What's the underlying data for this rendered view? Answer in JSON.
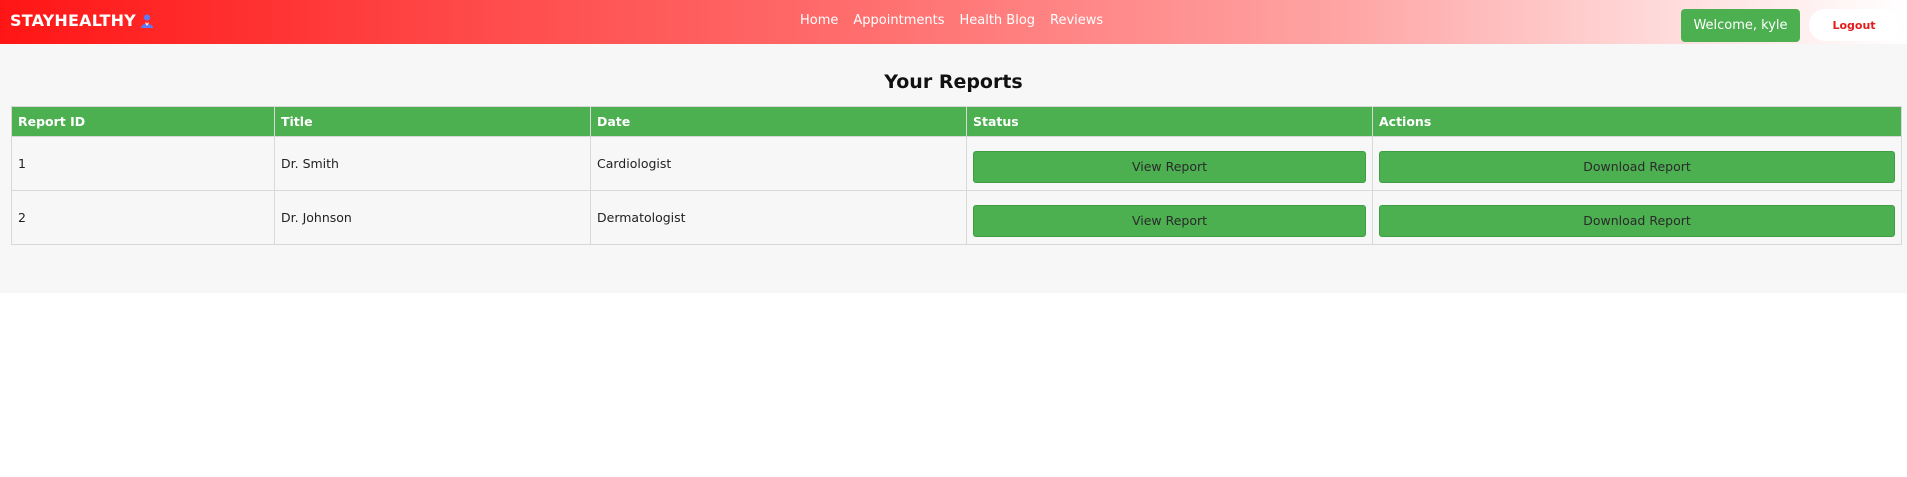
{
  "brand": {
    "name": "STAYHEALTHY",
    "icon": "doctor-icon"
  },
  "nav": {
    "links": [
      "Home",
      "Appointments",
      "Health Blog",
      "Reviews"
    ]
  },
  "user": {
    "welcome_label": "Welcome, kyle",
    "logout_label": "Logout"
  },
  "page": {
    "title": "Your Reports"
  },
  "table": {
    "headers": [
      "Report ID",
      "Title",
      "Date",
      "Status",
      "Actions"
    ],
    "rows": [
      {
        "id": "1",
        "title": "Dr. Smith",
        "date": "Cardiologist",
        "status_btn": "View Report",
        "action_btn": "Download Report"
      },
      {
        "id": "2",
        "title": "Dr. Johnson",
        "date": "Dermatologist",
        "status_btn": "View Report",
        "action_btn": "Download Report"
      }
    ]
  },
  "colors": {
    "accent_green": "#4caf50",
    "brand_red": "#ff1515",
    "logout_text": "#e41b1b"
  }
}
